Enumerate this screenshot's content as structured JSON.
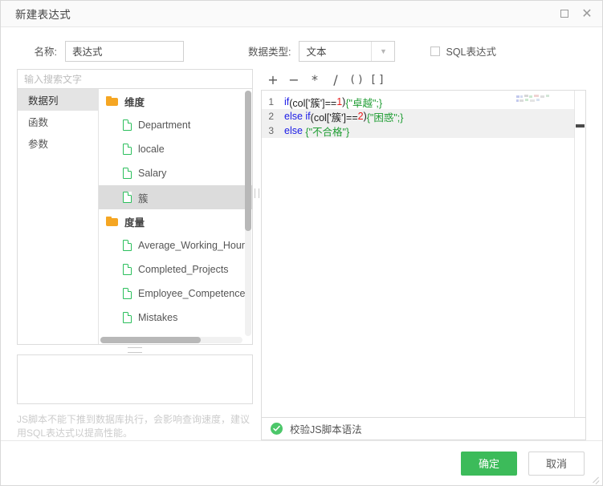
{
  "window": {
    "title": "新建表达式",
    "maximize_icon": "maximize-icon",
    "close_icon": "close-icon"
  },
  "form": {
    "name_label": "名称:",
    "name_value": "表达式",
    "datatype_label": "数据类型:",
    "datatype_value": "文本",
    "datatype_options": [
      "文本"
    ],
    "sql_checkbox_label": "SQL表达式",
    "sql_checkbox_checked": false
  },
  "left_panel": {
    "search_placeholder": "输入搜索文字",
    "tabs": [
      {
        "label": "数据列",
        "active": true
      },
      {
        "label": "函数",
        "active": false
      },
      {
        "label": "参数",
        "active": false
      }
    ],
    "tree": [
      {
        "label": "维度",
        "type": "folder",
        "selected": false
      },
      {
        "label": "Department",
        "type": "leaf",
        "selected": false
      },
      {
        "label": "locale",
        "type": "leaf",
        "selected": false
      },
      {
        "label": "Salary",
        "type": "leaf",
        "selected": false
      },
      {
        "label": "簇",
        "type": "leaf",
        "selected": true
      },
      {
        "label": "度量",
        "type": "folder",
        "selected": false
      },
      {
        "label": "Average_Working_Hours",
        "type": "leaf",
        "selected": false
      },
      {
        "label": "Completed_Projects",
        "type": "leaf",
        "selected": false
      },
      {
        "label": "Employee_Competence",
        "type": "leaf",
        "selected": false
      },
      {
        "label": "Mistakes",
        "type": "leaf",
        "selected": false
      }
    ],
    "description_panel_text": ""
  },
  "hint": "JS脚本不能下推到数据库执行，会影响查询速度，建议用SQL表达式以提高性能。",
  "editor": {
    "operators": [
      "+",
      "−",
      "*",
      "/",
      "( )",
      "[ ]"
    ],
    "lines": [
      {
        "number": "1",
        "highlight": false,
        "tokens": [
          {
            "text": "if",
            "kind": "kw"
          },
          {
            "text": "(col['簇']==",
            "kind": "plain"
          },
          {
            "text": "1",
            "kind": "num"
          },
          {
            "text": ")",
            "kind": "plain"
          },
          {
            "text": "{\"卓越\";}",
            "kind": "str"
          }
        ]
      },
      {
        "number": "2",
        "highlight": true,
        "tokens": [
          {
            "text": "else if",
            "kind": "kw"
          },
          {
            "text": "(col['簇']==",
            "kind": "plain"
          },
          {
            "text": "2",
            "kind": "num"
          },
          {
            "text": ")",
            "kind": "plain"
          },
          {
            "text": "{\"困惑\";}",
            "kind": "str"
          }
        ]
      },
      {
        "number": "3",
        "highlight": true,
        "tokens": [
          {
            "text": "else ",
            "kind": "kw"
          },
          {
            "text": "{\"不合格\"}",
            "kind": "str"
          }
        ]
      }
    ],
    "validate_label": "校验JS脚本语法",
    "validate_icon": "check-circle-icon",
    "validate_ok": true
  },
  "footer": {
    "confirm_label": "确定",
    "cancel_label": "取消"
  },
  "colors": {
    "primary": "#3cbb5a",
    "keyword": "#1a1ae6",
    "string": "#1f9d33",
    "number": "#e61a1a",
    "folder": "#f5a623",
    "file": "#2bbf5c"
  }
}
